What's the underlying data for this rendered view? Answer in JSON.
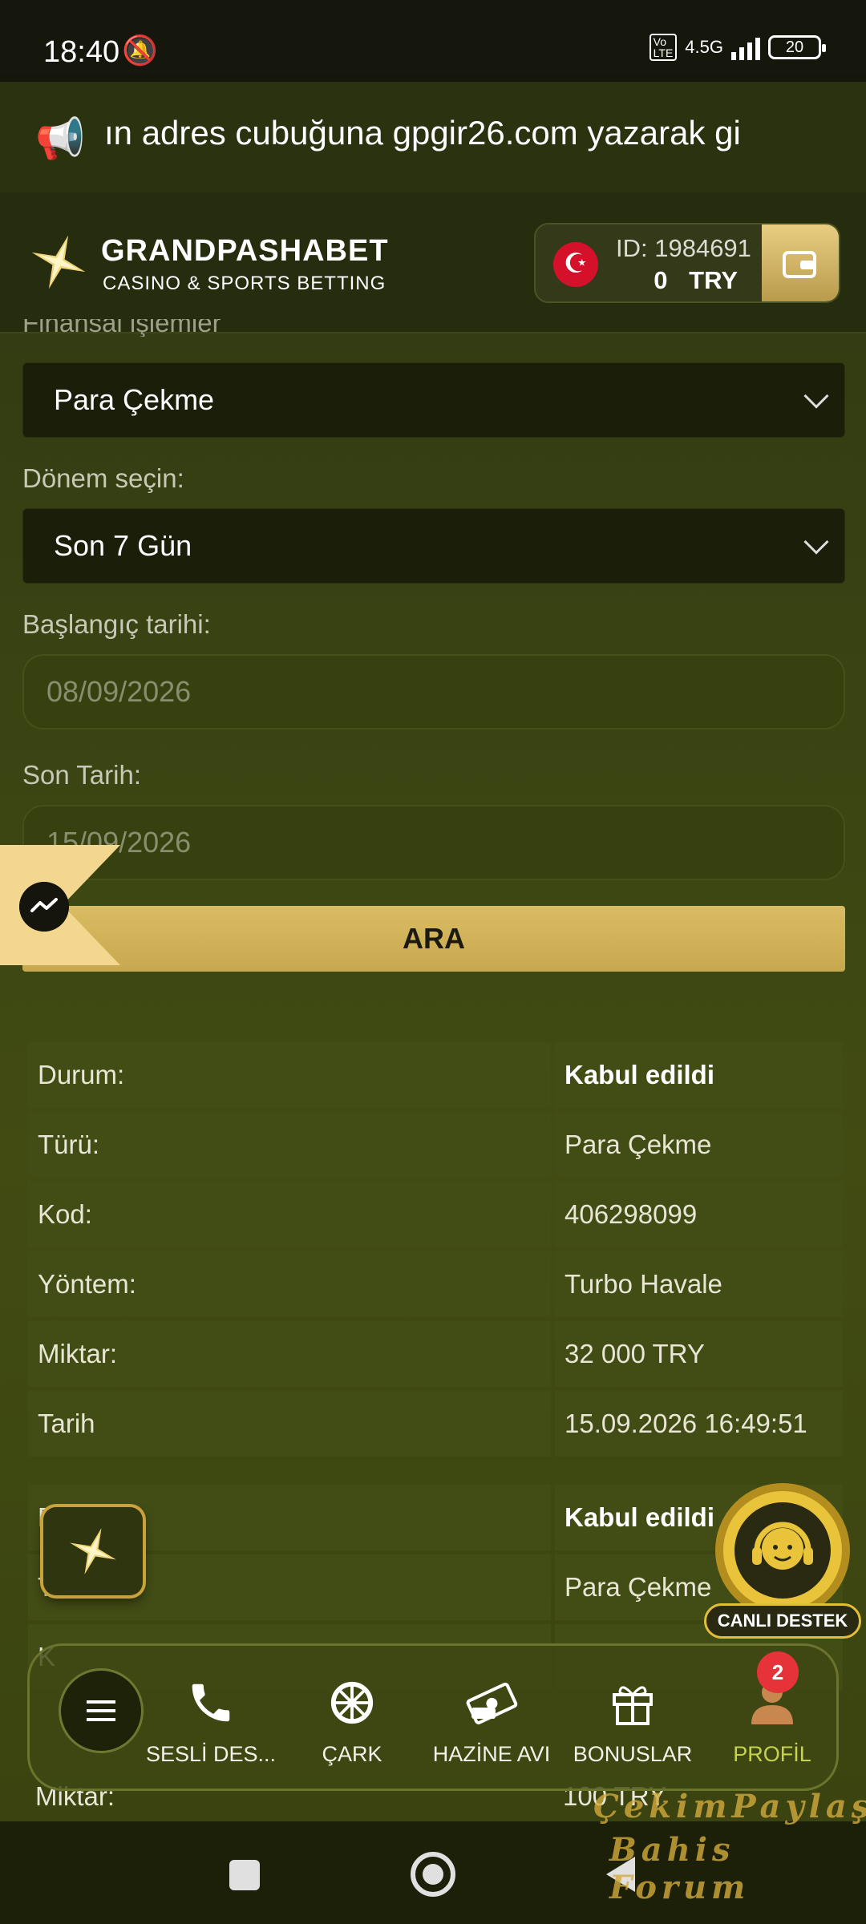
{
  "status_bar": {
    "time": "18:40",
    "network": "4.5G",
    "battery": "20"
  },
  "announcement": {
    "text": "ın adres cubuğuna gpgir26.com yazarak gi"
  },
  "header": {
    "brand": "GRANDPASHABET",
    "tagline": "CASINO & SPORTS BETTING",
    "account_id": "ID: 1984691",
    "balance_amount": "0",
    "balance_currency": "TRY"
  },
  "filters": {
    "finance_label": "Finansal işlemler",
    "finance_value": "Para Çekme",
    "period_label": "Dönem seçin:",
    "period_value": "Son 7 Gün",
    "start_label": "Başlangıç tarihi:",
    "start_value": "08/09/2026",
    "end_label": "Son Tarih:",
    "end_value": "15/09/2026",
    "search_button": "ARA"
  },
  "transactions": [
    {
      "rows": [
        {
          "label": "Durum:",
          "value": "Kabul edildi"
        },
        {
          "label": "Türü:",
          "value": "Para Çekme"
        },
        {
          "label": "Kod:",
          "value": "406298099"
        },
        {
          "label": "Yöntem:",
          "value": "Turbo Havale"
        },
        {
          "label": "Miktar:",
          "value": "32 000 TRY"
        },
        {
          "label": "Tarih",
          "value": "15.09.2026 16:49:51"
        }
      ]
    },
    {
      "rows": [
        {
          "label": "D",
          "value": "Kabul edildi"
        },
        {
          "label": "T",
          "value": "Para Çekme"
        },
        {
          "label": "K",
          "value": ""
        }
      ],
      "partial_bottom": {
        "label": "Miktar:",
        "value": "100 TRY"
      }
    }
  ],
  "support": {
    "label": "CANLI DESTEK"
  },
  "bottom_nav": {
    "items": [
      {
        "label": "SESLİ DES...",
        "icon": "phone-icon"
      },
      {
        "label": "ÇARK",
        "icon": "wheel-icon"
      },
      {
        "label": "HAZİNE AVI",
        "icon": "money-icon"
      },
      {
        "label": "BONUSLAR",
        "icon": "gift-icon"
      },
      {
        "label": "PROFİL",
        "icon": "user-icon"
      }
    ],
    "profile_badge": "2"
  },
  "watermark": {
    "line1": "ÇekimPaylaş",
    "line2": "Bahis Forum"
  },
  "colors": {
    "accent_gold": "#d9bc63",
    "background": "#3b4513",
    "active_nav": "#c7d34d",
    "badge": "#e6333a"
  }
}
